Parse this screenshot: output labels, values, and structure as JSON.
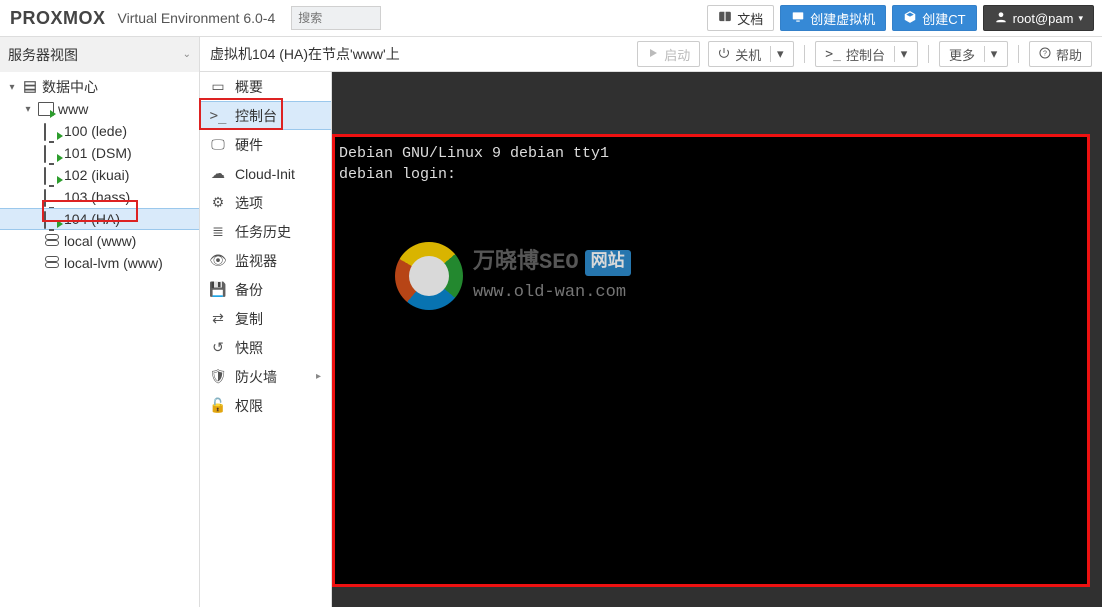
{
  "brand": {
    "name": "PROXMOX",
    "product": "Virtual Environment",
    "version": "6.0-4"
  },
  "search": {
    "placeholder": "搜索"
  },
  "topbuttons": {
    "docs": "文档",
    "create_vm": "创建虚拟机",
    "create_ct": "创建CT",
    "user": "root@pam"
  },
  "viewselect": {
    "label": "服务器视图"
  },
  "breadcrumb": "虚拟机104 (HA)在节点'www'上",
  "actions": {
    "start": "启动",
    "shutdown": "关机",
    "console": "控制台",
    "more": "更多",
    "help": "帮助"
  },
  "tree": {
    "datacenter": "数据中心",
    "node": "www",
    "vms": [
      {
        "id": "100",
        "label": "100 (lede)",
        "running": true
      },
      {
        "id": "101",
        "label": "101 (DSM)",
        "running": true
      },
      {
        "id": "102",
        "label": "102 (ikuai)",
        "running": true
      },
      {
        "id": "103",
        "label": "103 (hass)",
        "running": false
      },
      {
        "id": "104",
        "label": "104 (HA)",
        "running": true,
        "selected": true
      }
    ],
    "storage": [
      "local (www)",
      "local-lvm (www)"
    ]
  },
  "submenu": {
    "items": [
      "概要",
      "控制台",
      "硬件",
      "Cloud-Init",
      "选项",
      "任务历史",
      "监视器",
      "备份",
      "复制",
      "快照",
      "防火墙",
      "权限"
    ],
    "selected_index": 1
  },
  "console_output": [
    "Debian GNU/Linux 9 debian tty1",
    "",
    "debian login:"
  ],
  "watermark": {
    "title_main": "万晓博SEO",
    "title_badge": "网站",
    "sub": "www.old-wan.com"
  }
}
